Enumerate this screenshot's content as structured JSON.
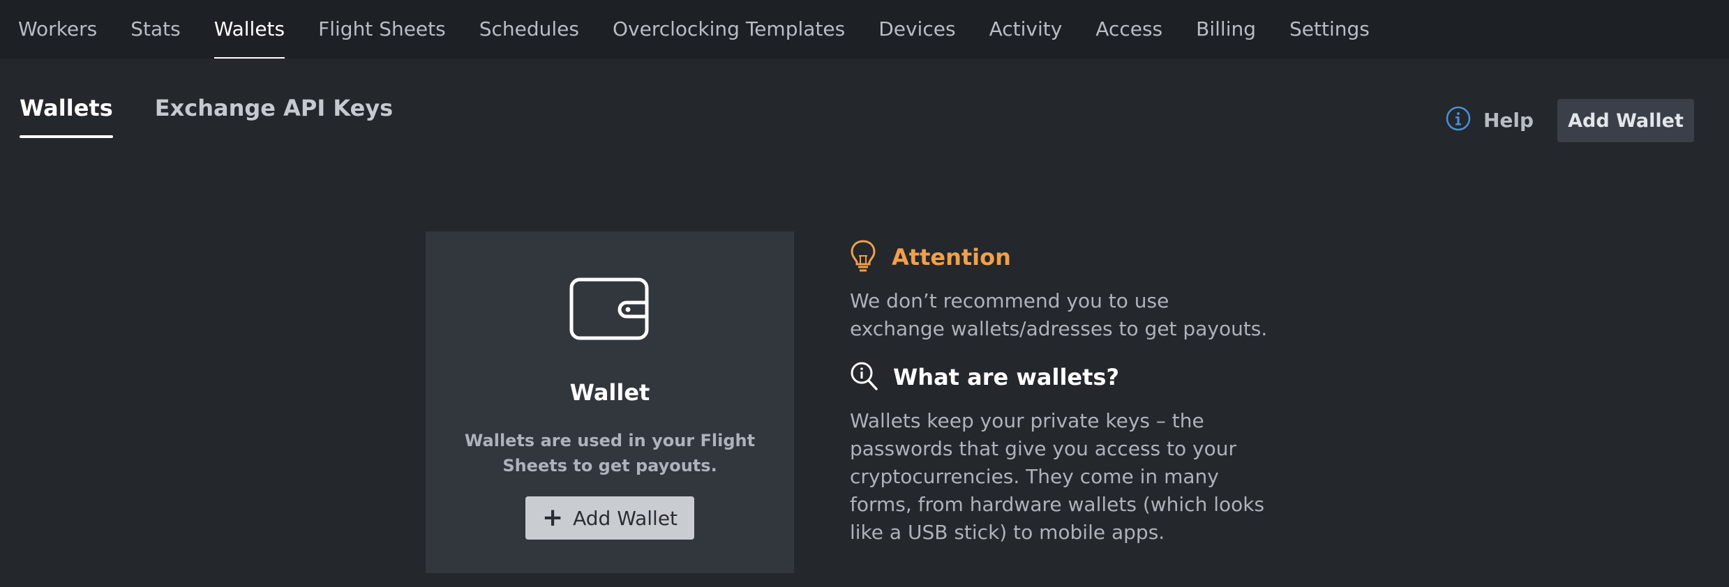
{
  "topnav": {
    "items": [
      {
        "label": "Workers"
      },
      {
        "label": "Stats"
      },
      {
        "label": "Wallets"
      },
      {
        "label": "Flight Sheets"
      },
      {
        "label": "Schedules"
      },
      {
        "label": "Overclocking Templates"
      },
      {
        "label": "Devices"
      },
      {
        "label": "Activity"
      },
      {
        "label": "Access"
      },
      {
        "label": "Billing"
      },
      {
        "label": "Settings"
      }
    ],
    "active": "Wallets"
  },
  "subtabs": {
    "items": [
      {
        "label": "Wallets"
      },
      {
        "label": "Exchange API Keys"
      }
    ],
    "active": "Wallets"
  },
  "header_actions": {
    "help_label": "Help",
    "help_icon": "info-icon",
    "add_wallet_label": "Add Wallet"
  },
  "card": {
    "icon": "wallet-icon",
    "title": "Wallet",
    "description": "Wallets are used in your Flight Sheets to get payouts.",
    "button_label": "Add Wallet",
    "button_icon": "plus-icon"
  },
  "info": {
    "attention": {
      "icon": "lightbulb-icon",
      "title": "Attention",
      "text": "We don’t recommend you to use exchange wallets/adresses to get payouts."
    },
    "what": {
      "icon": "magnifier-info-icon",
      "title": "What are wallets?",
      "text": "Wallets keep your private keys – the passwords that give you access to your cryptocurrencies. They come in many forms, from hardware wallets (which looks like a USB stick) to mobile apps."
    }
  },
  "colors": {
    "background": "#24272c",
    "topnav_bg": "#1d2024",
    "card_bg": "#32363d",
    "attention": "#f0a04b",
    "help_icon": "#4a90d9"
  }
}
